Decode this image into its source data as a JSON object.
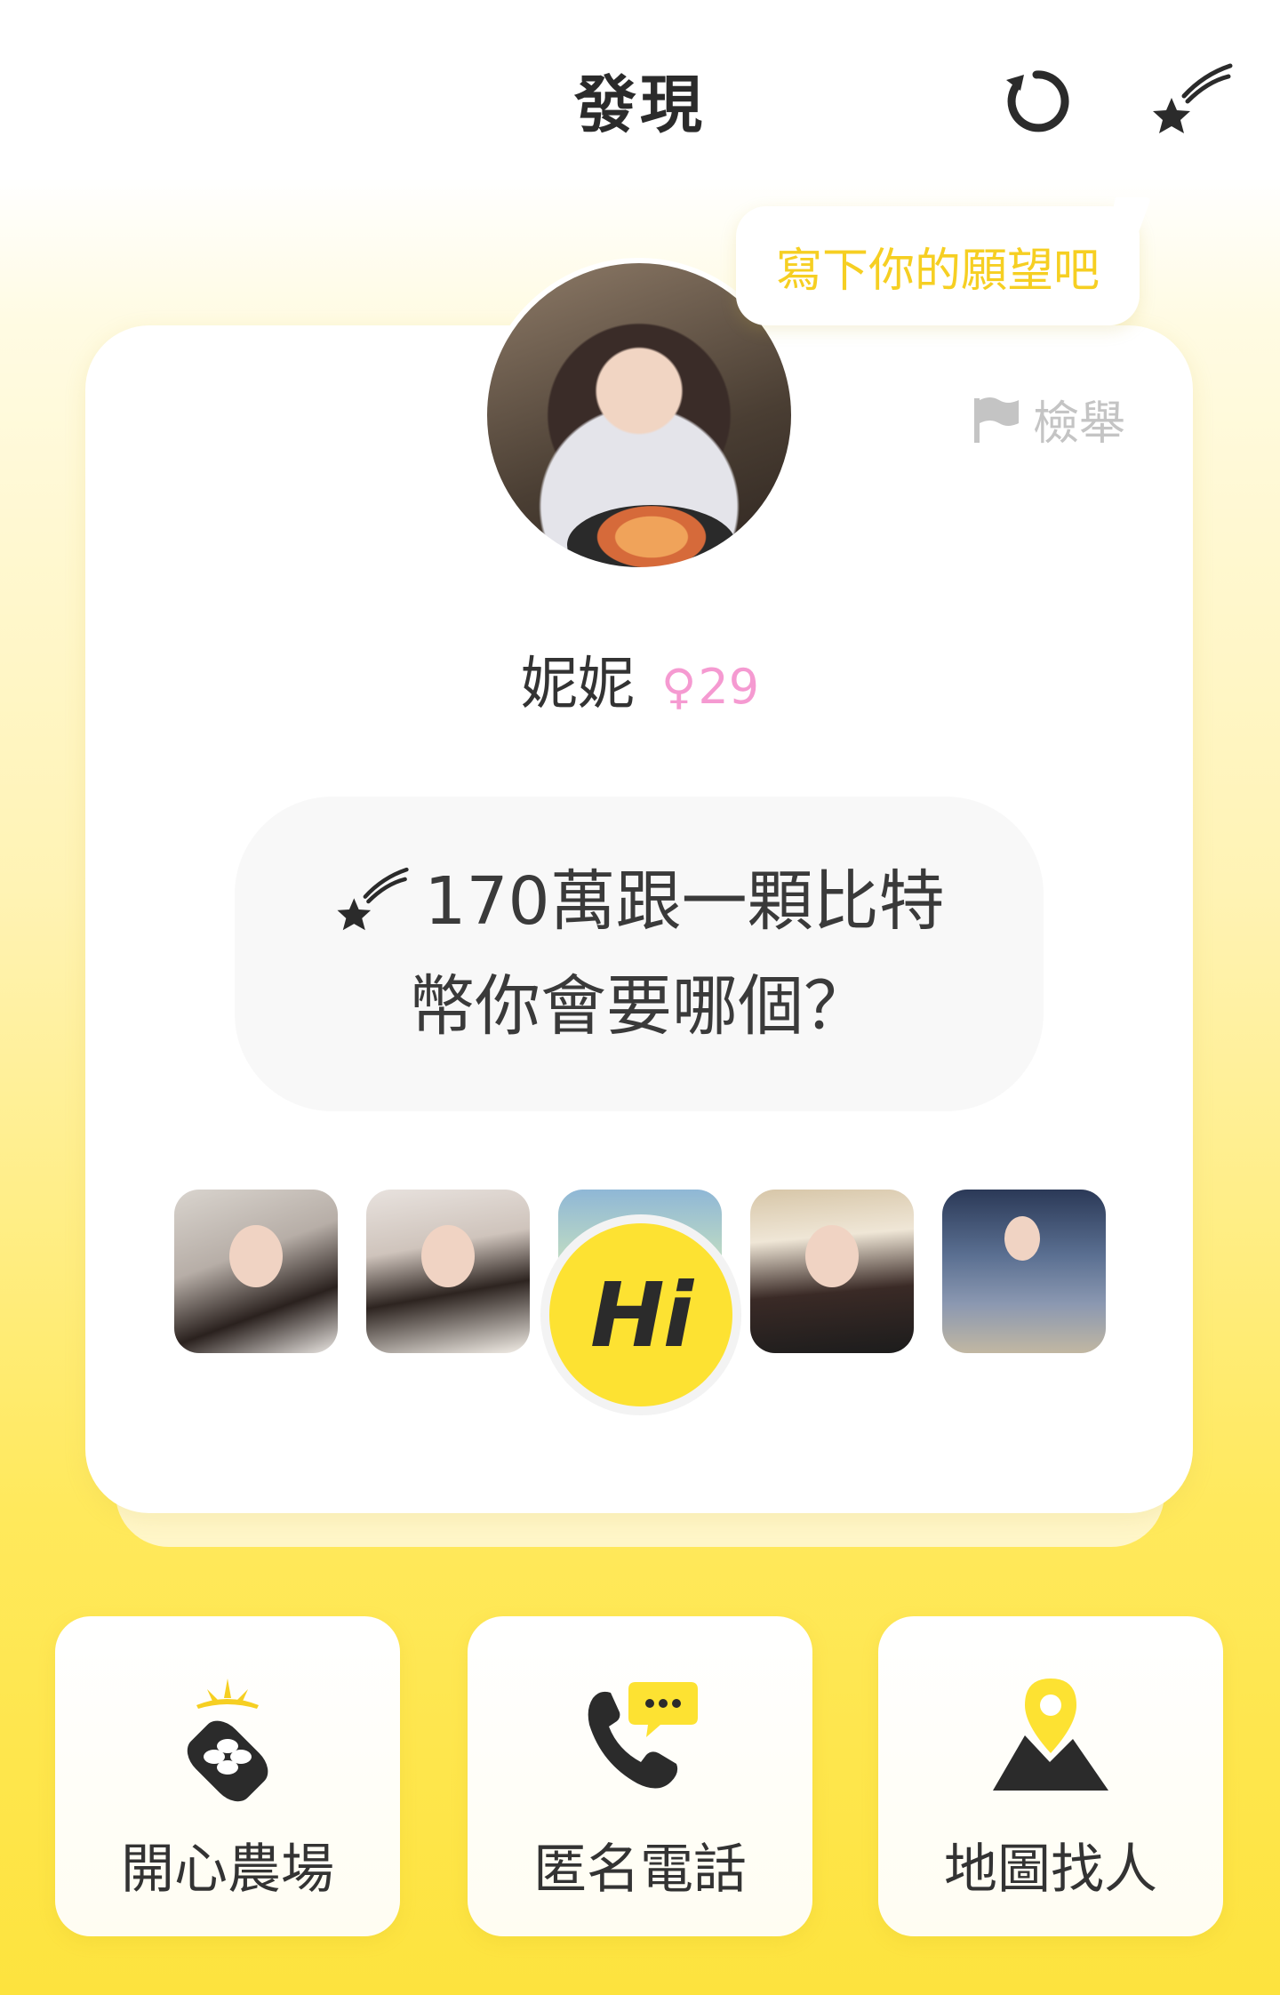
{
  "header": {
    "title": "發現",
    "refresh_icon": "refresh-icon",
    "wish_icon": "shooting-star-icon"
  },
  "wish_tip": {
    "text": "寫下你的願望吧"
  },
  "profile": {
    "report_label": "檢舉",
    "name": "妮妮",
    "gender_symbol": "♀",
    "age": "29",
    "wish_line1": "170萬跟一顆比特",
    "wish_line2": "幣你會要哪個？",
    "hi_label": "Hi"
  },
  "features": [
    {
      "label": "開心農場",
      "icon": "farm-icon"
    },
    {
      "label": "匿名電話",
      "icon": "anonymous-call-icon"
    },
    {
      "label": "地圖找人",
      "icon": "map-pin-icon"
    }
  ],
  "colors": {
    "accent_yellow": "#fde232",
    "tip_text": "#f6cf22",
    "age_pink": "#f59ad1"
  }
}
